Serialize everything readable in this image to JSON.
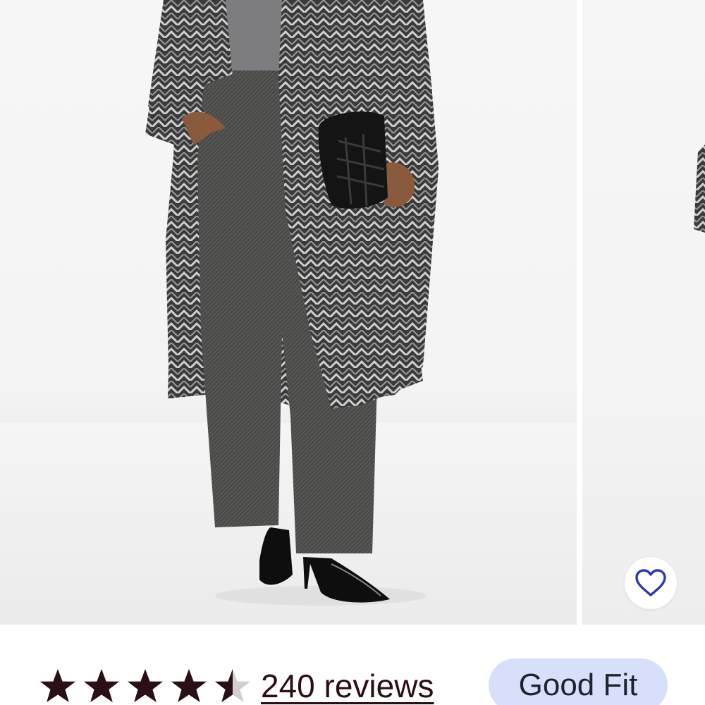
{
  "product": {
    "wishlist_icon": "heart-outline-icon",
    "accent_color": "#2d36b8"
  },
  "rating": {
    "value": 4.5,
    "max": 5,
    "star_color": "#2a0f14",
    "star_empty_color": "#cfcfcf",
    "reviews_label": "240 reviews",
    "fit_label": "Good Fit",
    "fit_badge_color": "#d7dffb"
  }
}
